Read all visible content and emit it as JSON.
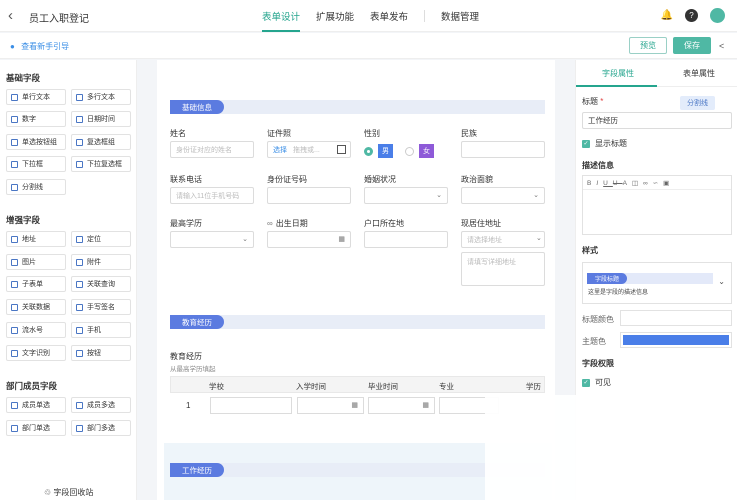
{
  "header": {
    "back_icon": "chevron-left-icon",
    "title": "员工入职登记",
    "tabs": [
      "表单设计",
      "扩展功能",
      "表单发布",
      "数据管理"
    ],
    "icons": [
      "bell-icon",
      "help-icon",
      "avatar"
    ]
  },
  "subbar": {
    "guide": "查看新手引导",
    "preview": "预览",
    "save": "保存",
    "share_icon": "share-icon"
  },
  "left": {
    "basic_title": "基础字段",
    "basic": [
      "单行文本",
      "多行文本",
      "数字",
      "日期时间",
      "单选按钮组",
      "复选框组",
      "下拉框",
      "下拉复选框",
      "分割线"
    ],
    "enhanced_title": "增强字段",
    "enhanced": [
      "地址",
      "定位",
      "图片",
      "附件",
      "子表单",
      "关联查询",
      "关联数据",
      "手写签名",
      "流水号",
      "手机",
      "文字识别",
      "按钮"
    ],
    "dept_title": "部门成员字段",
    "dept": [
      "成员单选",
      "成员多选",
      "部门单选",
      "部门多选"
    ],
    "recycle": "字段回收站"
  },
  "canvas": {
    "section1": "基础信息",
    "name_label": "姓名",
    "name_ph": "身份证对应的姓名",
    "id_label": "证件照",
    "id_select": "选择",
    "id_ph": "拖拽或...",
    "gender_label": "性别",
    "male": "男",
    "female": "女",
    "ethnic_label": "民族",
    "phone_label": "联系电话",
    "phone_ph": "请输入11位手机号码",
    "idnum_label": "身份证号码",
    "marital_label": "婚姻状况",
    "political_label": "政治面貌",
    "edu_label": "最高学历",
    "birth_label": "出生日期",
    "hukou_label": "户口所在地",
    "address_label": "现居住地址",
    "address_ph1": "请选择地址",
    "address_ph2": "请填写详细地址",
    "section2": "教育经历",
    "edu_table_title": "教育经历",
    "edu_table_hint": "从最高学历填起",
    "table_headers": [
      "学校",
      "入学时间",
      "毕业时间",
      "专业",
      "学历"
    ],
    "row_num": "1",
    "section3": "工作经历"
  },
  "right": {
    "tab_field": "字段属性",
    "tab_form": "表单属性",
    "title_label": "标题",
    "required_mark": "*",
    "divider_tag": "分割线",
    "title_value": "工作经历",
    "show_title": "显示标题",
    "desc_label": "描述信息",
    "style_label": "样式",
    "style_tag": "字段标题",
    "style_desc": "这里是字段的描述信息",
    "title_color_label": "标题颜色",
    "theme_color_label": "主题色",
    "theme_color": "#4a7ee8",
    "perm_label": "字段权限",
    "visible": "可见"
  },
  "colors": {
    "accent": "#25a58e",
    "section": "#5b7be0"
  }
}
